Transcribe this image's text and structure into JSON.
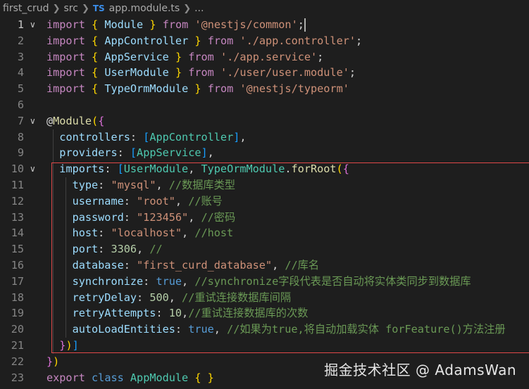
{
  "breadcrumb": {
    "items": [
      "first_crud",
      "src",
      "app.module.ts",
      "..."
    ],
    "file_icon": "TS"
  },
  "editor": {
    "line_numbers": [
      "1",
      "2",
      "3",
      "4",
      "5",
      "6",
      "7",
      "8",
      "9",
      "10",
      "11",
      "12",
      "13",
      "14",
      "15",
      "16",
      "17",
      "18",
      "19",
      "20",
      "21",
      "22",
      "23"
    ],
    "active_line": "1",
    "lines": [
      [
        [
          "kw",
          "import"
        ],
        [
          "pl",
          " "
        ],
        [
          "br1",
          "{"
        ],
        [
          "pl",
          " "
        ],
        [
          "id",
          "Module"
        ],
        [
          "pl",
          " "
        ],
        [
          "br1",
          "}"
        ],
        [
          "pl",
          " "
        ],
        [
          "kw",
          "from"
        ],
        [
          "pl",
          " "
        ],
        [
          "st",
          "'@nestjs/common'"
        ],
        [
          "pl",
          ";"
        ]
      ],
      [
        [
          "kw",
          "import"
        ],
        [
          "pl",
          " "
        ],
        [
          "br1",
          "{"
        ],
        [
          "pl",
          " "
        ],
        [
          "id",
          "AppController"
        ],
        [
          "pl",
          " "
        ],
        [
          "br1",
          "}"
        ],
        [
          "pl",
          " "
        ],
        [
          "kw",
          "from"
        ],
        [
          "pl",
          " "
        ],
        [
          "st",
          "'./app.controller'"
        ],
        [
          "pl",
          ";"
        ]
      ],
      [
        [
          "kw",
          "import"
        ],
        [
          "pl",
          " "
        ],
        [
          "br1",
          "{"
        ],
        [
          "pl",
          " "
        ],
        [
          "id",
          "AppService"
        ],
        [
          "pl",
          " "
        ],
        [
          "br1",
          "}"
        ],
        [
          "pl",
          " "
        ],
        [
          "kw",
          "from"
        ],
        [
          "pl",
          " "
        ],
        [
          "st",
          "'./app.service'"
        ],
        [
          "pl",
          ";"
        ]
      ],
      [
        [
          "kw",
          "import"
        ],
        [
          "pl",
          " "
        ],
        [
          "br1",
          "{"
        ],
        [
          "pl",
          " "
        ],
        [
          "id",
          "UserModule"
        ],
        [
          "pl",
          " "
        ],
        [
          "br1",
          "}"
        ],
        [
          "pl",
          " "
        ],
        [
          "kw",
          "from"
        ],
        [
          "pl",
          " "
        ],
        [
          "st",
          "'./user/user.module'"
        ],
        [
          "pl",
          ";"
        ]
      ],
      [
        [
          "kw",
          "import"
        ],
        [
          "pl",
          " "
        ],
        [
          "br1",
          "{"
        ],
        [
          "pl",
          " "
        ],
        [
          "id",
          "TypeOrmModule"
        ],
        [
          "pl",
          " "
        ],
        [
          "br1",
          "}"
        ],
        [
          "pl",
          " "
        ],
        [
          "kw",
          "from"
        ],
        [
          "pl",
          " "
        ],
        [
          "st",
          "'@nestjs/typeorm'"
        ]
      ],
      [],
      [
        [
          "pl",
          "@"
        ],
        [
          "fn",
          "Module"
        ],
        [
          "br1",
          "("
        ],
        [
          "br2",
          "{"
        ]
      ],
      [
        [
          "pl",
          "  "
        ],
        [
          "id",
          "controllers"
        ],
        [
          "pl",
          ": "
        ],
        [
          "br3",
          "["
        ],
        [
          "ty",
          "AppController"
        ],
        [
          "br3",
          "]"
        ],
        [
          "pl",
          ","
        ]
      ],
      [
        [
          "pl",
          "  "
        ],
        [
          "id",
          "providers"
        ],
        [
          "pl",
          ": "
        ],
        [
          "br3",
          "["
        ],
        [
          "ty",
          "AppService"
        ],
        [
          "br3",
          "]"
        ],
        [
          "pl",
          ","
        ]
      ],
      [
        [
          "pl",
          "  "
        ],
        [
          "id",
          "imports"
        ],
        [
          "pl",
          ": "
        ],
        [
          "br3",
          "["
        ],
        [
          "ty",
          "UserModule"
        ],
        [
          "pl",
          ", "
        ],
        [
          "ty",
          "TypeOrmModule"
        ],
        [
          "pl",
          "."
        ],
        [
          "fn",
          "forRoot"
        ],
        [
          "br1",
          "("
        ],
        [
          "br2",
          "{"
        ]
      ],
      [
        [
          "pl",
          "    "
        ],
        [
          "id",
          "type"
        ],
        [
          "pl",
          ": "
        ],
        [
          "st",
          "\"mysql\""
        ],
        [
          "pl",
          ", "
        ],
        [
          "cm",
          "//数据库类型"
        ]
      ],
      [
        [
          "pl",
          "    "
        ],
        [
          "id",
          "username"
        ],
        [
          "pl",
          ": "
        ],
        [
          "st",
          "\"root\""
        ],
        [
          "pl",
          ", "
        ],
        [
          "cm",
          "//账号"
        ]
      ],
      [
        [
          "pl",
          "    "
        ],
        [
          "id",
          "password"
        ],
        [
          "pl",
          ": "
        ],
        [
          "st",
          "\"123456\""
        ],
        [
          "pl",
          ", "
        ],
        [
          "cm",
          "//密码"
        ]
      ],
      [
        [
          "pl",
          "    "
        ],
        [
          "id",
          "host"
        ],
        [
          "pl",
          ": "
        ],
        [
          "st",
          "\"localhost\""
        ],
        [
          "pl",
          ", "
        ],
        [
          "cm",
          "//host"
        ]
      ],
      [
        [
          "pl",
          "    "
        ],
        [
          "id",
          "port"
        ],
        [
          "pl",
          ": "
        ],
        [
          "nu",
          "3306"
        ],
        [
          "pl",
          ", "
        ],
        [
          "cm",
          "//"
        ]
      ],
      [
        [
          "pl",
          "    "
        ],
        [
          "id",
          "database"
        ],
        [
          "pl",
          ": "
        ],
        [
          "st",
          "\"first_curd_database\""
        ],
        [
          "pl",
          ", "
        ],
        [
          "cm",
          "//库名"
        ]
      ],
      [
        [
          "pl",
          "    "
        ],
        [
          "id",
          "synchronize"
        ],
        [
          "pl",
          ": "
        ],
        [
          "sk",
          "true"
        ],
        [
          "pl",
          ", "
        ],
        [
          "cm",
          "//synchronize字段代表是否自动将实体类同步到数据库"
        ]
      ],
      [
        [
          "pl",
          "    "
        ],
        [
          "id",
          "retryDelay"
        ],
        [
          "pl",
          ": "
        ],
        [
          "nu",
          "500"
        ],
        [
          "pl",
          ", "
        ],
        [
          "cm",
          "//重试连接数据库间隔"
        ]
      ],
      [
        [
          "pl",
          "    "
        ],
        [
          "id",
          "retryAttempts"
        ],
        [
          "pl",
          ": "
        ],
        [
          "nu",
          "10"
        ],
        [
          "pl",
          ","
        ],
        [
          "cm",
          "//重试连接数据库的次数"
        ]
      ],
      [
        [
          "pl",
          "    "
        ],
        [
          "id",
          "autoLoadEntities"
        ],
        [
          "pl",
          ": "
        ],
        [
          "sk",
          "true"
        ],
        [
          "pl",
          ", "
        ],
        [
          "cm",
          "//如果为true,将自动加载实体 forFeature()方法注册"
        ]
      ],
      [
        [
          "pl",
          "  "
        ],
        [
          "br2",
          "}"
        ],
        [
          "br1",
          ")"
        ],
        [
          "br3",
          "]"
        ]
      ],
      [
        [
          "br2",
          "}"
        ],
        [
          "br1",
          ")"
        ]
      ],
      [
        [
          "kw",
          "export"
        ],
        [
          "pl",
          " "
        ],
        [
          "sk",
          "class"
        ],
        [
          "pl",
          " "
        ],
        [
          "ty",
          "AppModule"
        ],
        [
          "pl",
          " "
        ],
        [
          "br1",
          "{"
        ],
        [
          "pl",
          " "
        ],
        [
          "br1",
          "}"
        ]
      ]
    ],
    "fold_lines": [
      "1",
      "7",
      "10"
    ]
  },
  "watermark": "掘金技术社区 @ AdamsWan",
  "colors": {
    "background": "#1e1e1e",
    "highlight_box": "#e04848"
  }
}
